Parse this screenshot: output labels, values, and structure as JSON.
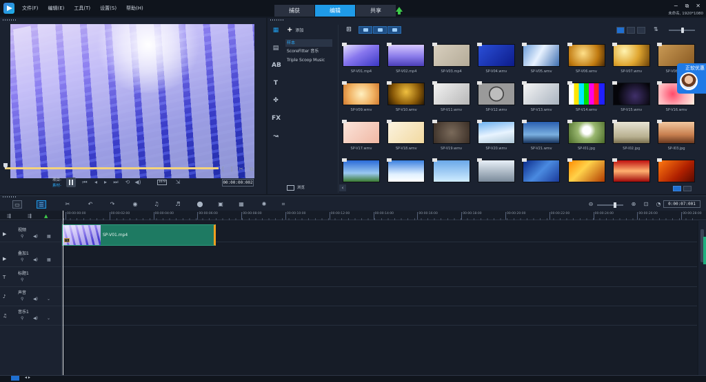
{
  "menu": {
    "items": [
      "文件(F)",
      "编辑(E)",
      "工具(T)",
      "设置(S)",
      "帮助(H)"
    ]
  },
  "modes": {
    "capture": "捕获",
    "edit": "编辑",
    "share": "共享"
  },
  "window": {
    "minimize": "−",
    "maximize": "⧉",
    "close": "✕",
    "project_info": "未命名, 1920*1080"
  },
  "player": {
    "project_label": "项目-",
    "clip_label": "素材-",
    "aspect": "16:9",
    "timecode": "00:00:00:002"
  },
  "library": {
    "add_label": "添加",
    "folders": [
      "样本",
      "ScoreFitter 音乐",
      "Triple Scoop Music"
    ],
    "browse_label": "浏览",
    "promo_text": "正软优惠",
    "thumbnails": [
      {
        "cap": "SP-V01.mp4",
        "bg": "linear-gradient(150deg,#e6e0ff,#8877ee 45%,#3a37c5)"
      },
      {
        "cap": "SP-V02.mp4",
        "bg": "linear-gradient(180deg,#d7c8ff,#8a7bea 55%,#4b3fb8)"
      },
      {
        "cap": "SP-V03.mp4",
        "bg": "linear-gradient(135deg,#d8cfbe,#b4ab98)"
      },
      {
        "cap": "SP-V04.wmv",
        "bg": "linear-gradient(135deg,#2a4fd8,#0d1c8a)"
      },
      {
        "cap": "SP-V05.wmv",
        "bg": "linear-gradient(120deg,#6a9bd8,#e8f2ff 45%,#3e6fb0)"
      },
      {
        "cap": "SP-V06.wmv",
        "bg": "radial-gradient(circle at 40% 40%,#ffe08a,#c07a10 60%,#4a2a05)"
      },
      {
        "cap": "SP-V07.wmv",
        "bg": "radial-gradient(circle at 30% 30%,#fff3b0,#e0a630 50%,#6a4006)"
      },
      {
        "cap": "SP-V08.wmv",
        "bg": "linear-gradient(135deg,#c99a55,#8a5a22)"
      },
      {
        "cap": "SP-V09.wmv",
        "bg": "radial-gradient(circle at 50% 50%,#fff0c0,#f0b060 60%,#d07a30)"
      },
      {
        "cap": "SP-V10.wmv",
        "bg": "radial-gradient(circle at 50% 40%,#f0c040,#8a5a08 60%,#2a1802)"
      },
      {
        "cap": "SP-V11.wmv",
        "bg": "linear-gradient(135deg,#f2f2f2,#b8b8b8)"
      },
      {
        "cap": "SP-V12.wmv",
        "bg": "radial-gradient(circle,#bdbdbd 0 30%,#4a4a4a 31% 36%,#9a9a9a 37%)"
      },
      {
        "cap": "SP-V13.wmv",
        "bg": "linear-gradient(135deg,#f5f5f5,#aab4c0)"
      },
      {
        "cap": "SP-V14.wmv",
        "bg": "linear-gradient(90deg,#ffffff 0 14%,#ffe600 14% 28%,#00e6ff 28% 42%,#00e000 42% 56%,#ff00e6 56% 70%,#ff2020 70% 84%,#2020ff 84%)"
      },
      {
        "cap": "SP-V15.wmv",
        "bg": "radial-gradient(circle at 60% 60%,#40306a,#05050a 70%)"
      },
      {
        "cap": "SP-V16.wmv",
        "bg": "radial-gradient(circle at 40% 50%,#ff4a6a,#ffb0b8 50%,#fff0e0)"
      },
      {
        "cap": "SP-V17.wmv",
        "bg": "linear-gradient(135deg,#fbe4da,#f0b8a4)"
      },
      {
        "cap": "SP-V18.wmv",
        "bg": "linear-gradient(135deg,#fbf3e0,#f2d9a0)"
      },
      {
        "cap": "SP-V19.wmv",
        "bg": "radial-gradient(circle,#7a6a5a,#3a2e26)"
      },
      {
        "cap": "SP-V20.wmv",
        "bg": "linear-gradient(170deg,#6ab0f0,#e8f4ff 55%,#b0c8d8)"
      },
      {
        "cap": "SP-V21.wmv",
        "bg": "linear-gradient(180deg,#2a5fb0,#7ab0e0 60%,#15305a)"
      },
      {
        "cap": "SP-I01.jpg",
        "bg": "radial-gradient(circle at 50% 40%,#ffffff 0 18%,#9ab870 40%,#4a6a28)"
      },
      {
        "cap": "SP-I02.jpg",
        "bg": "linear-gradient(180deg,#e8e4d4,#b8b090 70%,#7a7050)"
      },
      {
        "cap": "SP-I03.jpg",
        "bg": "linear-gradient(180deg,#f2c8a0,#c88050 60%,#6a3a20)"
      },
      {
        "cap": "",
        "bg": "linear-gradient(180deg,#2a6ad8,#9ac8f0 60%,#3a7a30)"
      },
      {
        "cap": "",
        "bg": "linear-gradient(180deg,#3a80e0,#e0f0ff 65%,#ffffff)"
      },
      {
        "cap": "",
        "bg": "linear-gradient(180deg,#6aa8e8,#d0ecff)"
      },
      {
        "cap": "",
        "bg": "linear-gradient(180deg,#e8f0f8,#7a8a9a)"
      },
      {
        "cap": "",
        "bg": "linear-gradient(135deg,#0a2a8a,#4a8ae0 50%,#1a3a9a)"
      },
      {
        "cap": "",
        "bg": "linear-gradient(135deg,#ff8a00,#ffd24a 40%,#b03a00)"
      },
      {
        "cap": "",
        "bg": "linear-gradient(180deg,#c01010,#ffb070 50%,#a00808)"
      },
      {
        "cap": "",
        "bg": "linear-gradient(135deg,#ff7a10,#b02000 60%,#5a0a00)"
      }
    ]
  },
  "timeline": {
    "timecode": "0:00:07:001",
    "ruler": [
      "00:00:00:00",
      "00:00:02:00",
      "00:00:04:00",
      "00:00:06:00",
      "00:00:08:00",
      "00:00:10:00",
      "00:00:12:00",
      "00:00:14:00",
      "00:00:16:00",
      "00:00:18:00",
      "00:00:20:00",
      "00:00:22:00",
      "00:00:24:00",
      "00:00:26:00",
      "00:00:28:00"
    ],
    "tracks": [
      "视频",
      "叠加1",
      "标题1",
      "声音",
      "音乐1"
    ],
    "clip_name": "SP-V01.mp4",
    "clip_fx": "FX"
  }
}
